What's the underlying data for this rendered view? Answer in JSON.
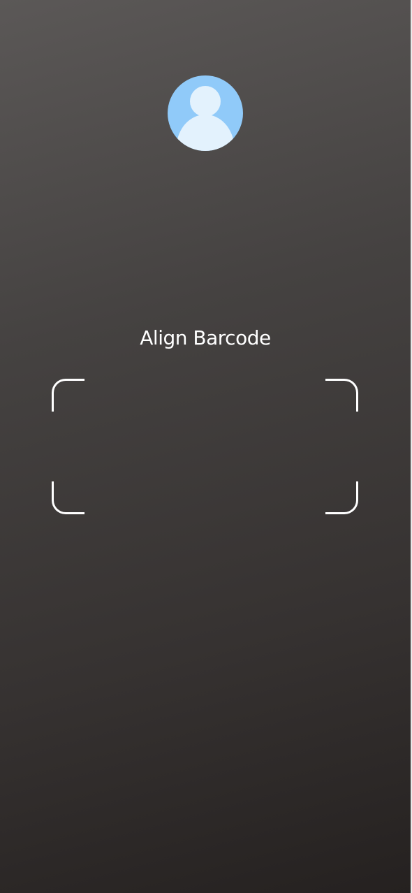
{
  "scanner": {
    "avatar_icon": "user-avatar-icon",
    "prompt": "Align Barcode",
    "frame_icon": "barcode-scan-frame"
  },
  "colors": {
    "avatar_background": "#90caf9",
    "avatar_figure": "#e3f2fd",
    "prompt_text": "#ffffff",
    "frame_stroke": "#ffffff"
  }
}
